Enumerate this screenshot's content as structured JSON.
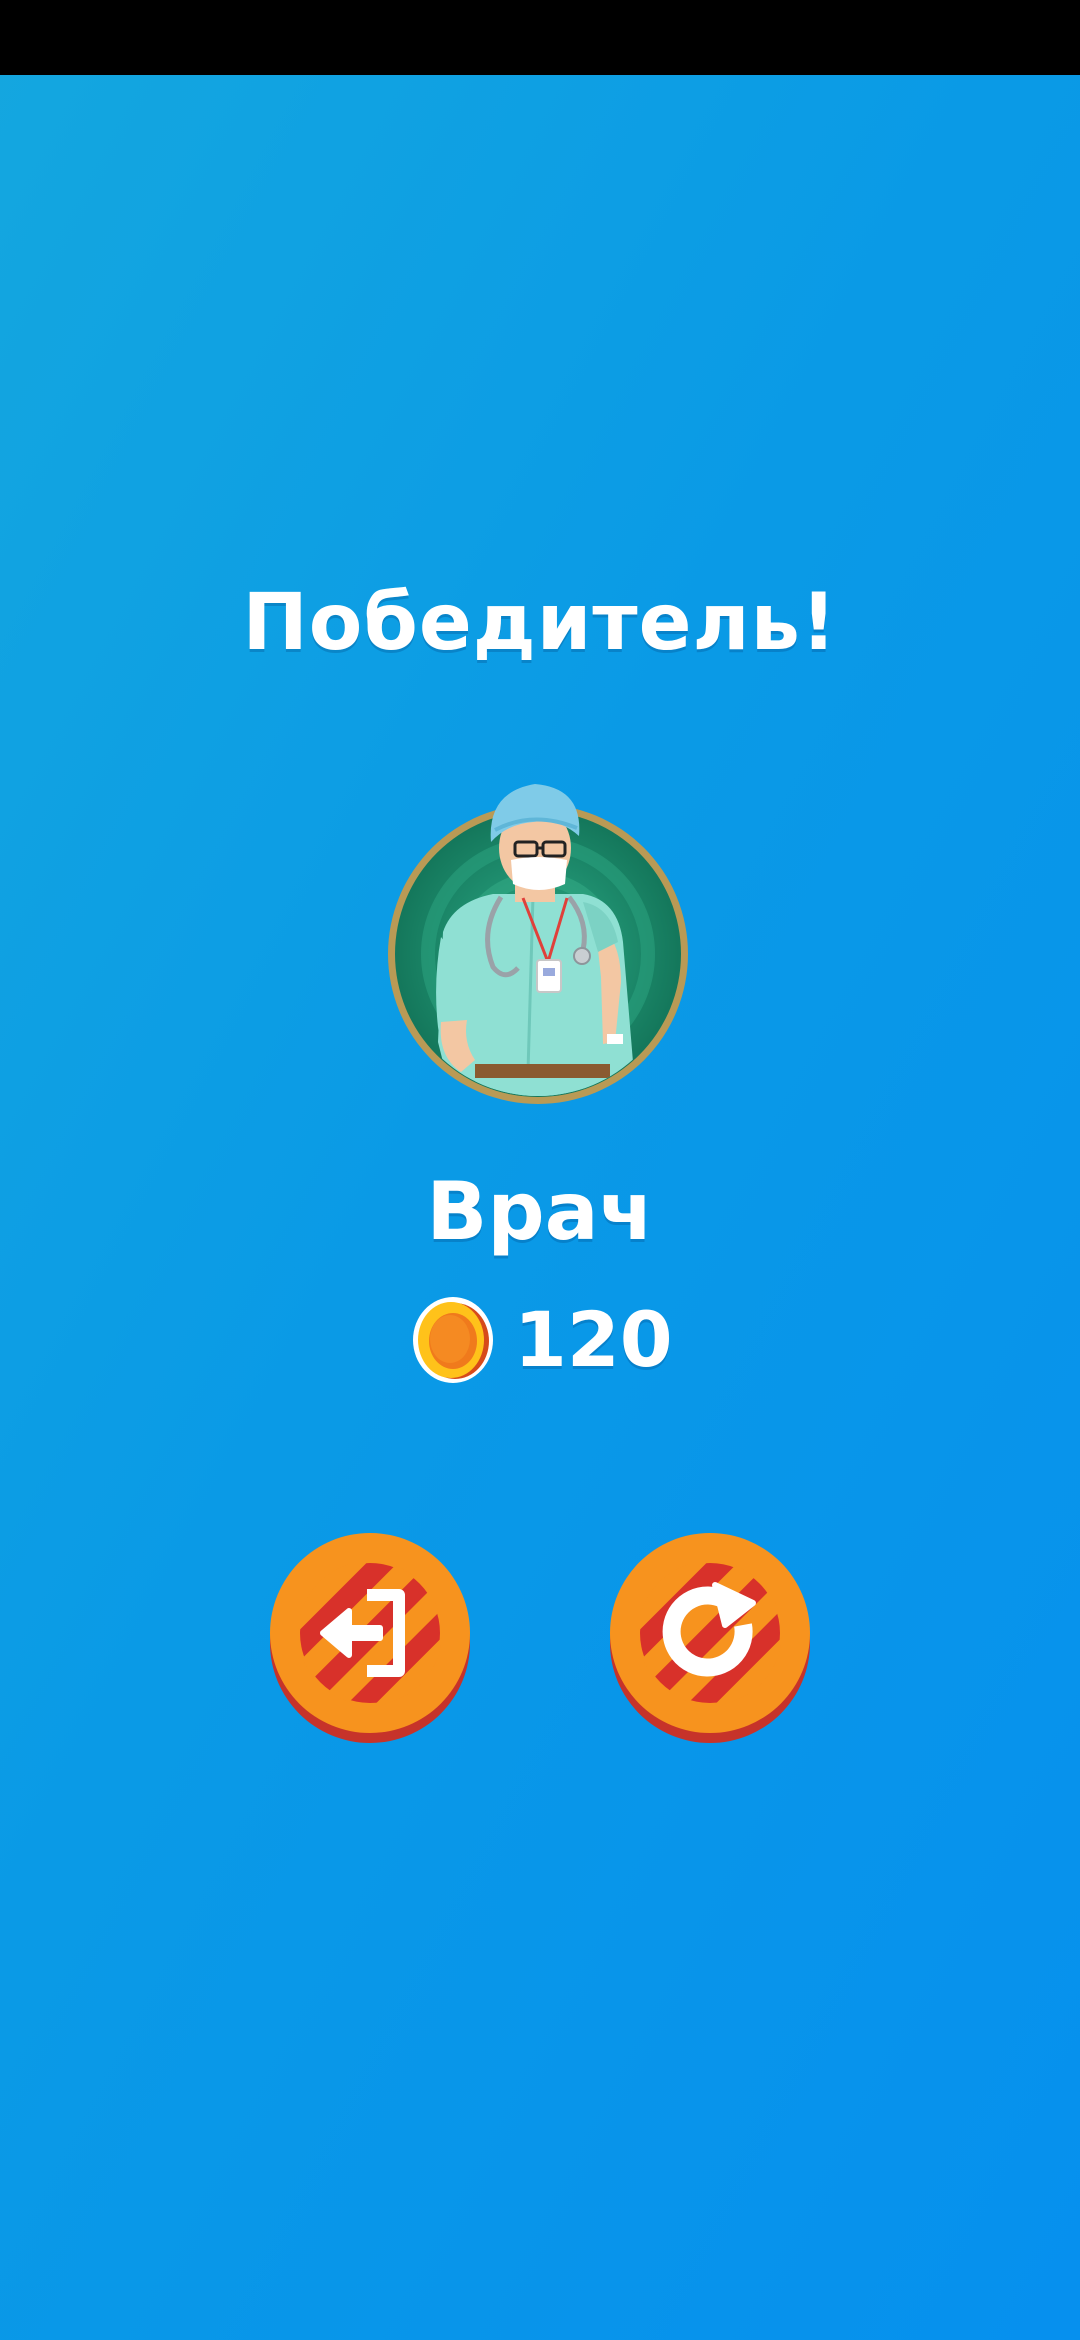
{
  "header": {
    "title": "Победитель!"
  },
  "winner": {
    "role": "Врач",
    "avatar_icon": "doctor-avatar",
    "coins": "120",
    "coin_icon": "coin-icon"
  },
  "actions": [
    {
      "name": "exit",
      "icon": "exit-icon"
    },
    {
      "name": "restart",
      "icon": "restart-icon"
    }
  ],
  "colors": {
    "background_start": "#14a7df",
    "background_end": "#0690ee",
    "button_orange": "#f7931e",
    "button_red": "#d8312a",
    "coin_gold": "#ffc21a"
  }
}
